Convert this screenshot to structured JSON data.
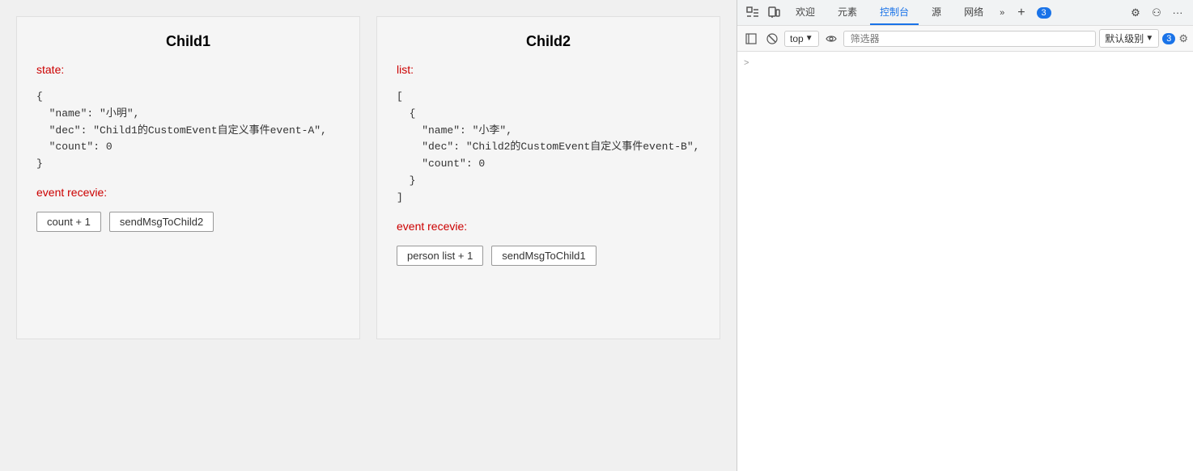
{
  "main": {
    "child1": {
      "title": "Child1",
      "state_label": "state:",
      "state_json": "{\n  \"name\": \"小明\",\n  \"dec\": \"Child1的CustomEvent自定义事件event-A\",\n  \"count\": 0\n}",
      "event_label": "event recevie:",
      "btn_count": "count + 1",
      "btn_send": "sendMsgToChild2"
    },
    "child2": {
      "title": "Child2",
      "list_label": "list:",
      "list_json": "[\n  {\n    \"name\": \"小李\",\n    \"dec\": \"Child2的CustomEvent自定义事件event-B\",\n    \"count\": 0\n  }\n]",
      "event_label": "event recevie:",
      "btn_person": "person list + 1",
      "btn_send": "sendMsgToChild1"
    }
  },
  "devtools": {
    "topbar": {
      "icons": [
        "inspect-icon",
        "device-icon"
      ],
      "tabs": [
        {
          "label": "欢迎",
          "active": false
        },
        {
          "label": "元素",
          "active": false
        },
        {
          "label": "控制台",
          "active": true
        },
        {
          "label": "源",
          "active": false
        },
        {
          "label": "网络",
          "active": false
        }
      ],
      "more_label": "»",
      "plus_label": "+",
      "badge_count": "3",
      "settings_label": "⚙",
      "profile_label": "⚇",
      "dots_label": "···"
    },
    "toolbar": {
      "block_icon": "block-icon",
      "clear_icon": "clear-icon",
      "top_dropdown": "top",
      "eye_icon": "eye-icon",
      "filter_placeholder": "筛选器",
      "level_label": "默认级别",
      "level_badge": "3",
      "settings_icon": "settings-icon"
    },
    "content": {
      "arrow": ">"
    }
  }
}
